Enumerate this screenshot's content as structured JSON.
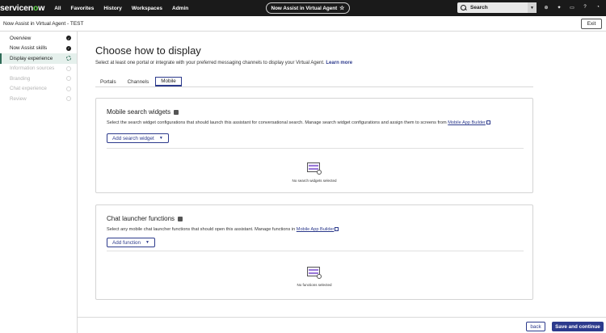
{
  "topnav": {
    "brand_prefix": "servicen",
    "brand_o": "o",
    "brand_suffix": "w",
    "menu": [
      "All",
      "Favorites",
      "History",
      "Workspaces",
      "Admin"
    ],
    "context_pill": "Now Assist in Virtual Agent",
    "context_star": "☆",
    "search_label": "Search",
    "icons": [
      "globe-icon",
      "sparkle-icon",
      "chat-icon",
      "help-icon",
      "bell-icon",
      "avatar"
    ]
  },
  "subheader": {
    "title": "Now Assist in Virtual Agent - TEST",
    "exit_label": "Exit"
  },
  "sidebar": {
    "items": [
      {
        "label": "Overview",
        "state": "done"
      },
      {
        "label": "Now Assist skills",
        "state": "done"
      },
      {
        "label": "Display experience",
        "state": "active"
      },
      {
        "label": "Information sources",
        "state": "pending"
      },
      {
        "label": "Branding",
        "state": "pending"
      },
      {
        "label": "Chat experience",
        "state": "pending"
      },
      {
        "label": "Review",
        "state": "pending"
      }
    ]
  },
  "main": {
    "title": "Choose how to display",
    "intro": "Select at least one portal or integrate with your preferred messaging channels to display your Virtual Agent.",
    "learn_more": "Learn more",
    "tabs": [
      "Portals",
      "Channels",
      "Mobile"
    ],
    "selected_tab": "Mobile",
    "panels": {
      "search": {
        "title": "Mobile search widgets",
        "desc": "Select the search widget configurations that should launch this assistant for conversational search.  Manage search widget configurations and assign them to screens from",
        "link": "Mobile App Builder",
        "button": "Add search widget",
        "empty": "No search widgets selected"
      },
      "chat": {
        "title": "Chat launcher functions",
        "desc": "Select any mobile chat launcher functions that should open this assistant. Manage functions in",
        "link": "Mobile App Builder",
        "button": "Add function",
        "empty": "No functions selected"
      }
    }
  },
  "footer": {
    "back_label": "back",
    "save_label": "Save and continue"
  },
  "colors": {
    "accent": "#2c3a8c",
    "active_step": "#2f6b57",
    "nav_bg": "#1a1a1a",
    "logo_o": "#62d84e"
  }
}
